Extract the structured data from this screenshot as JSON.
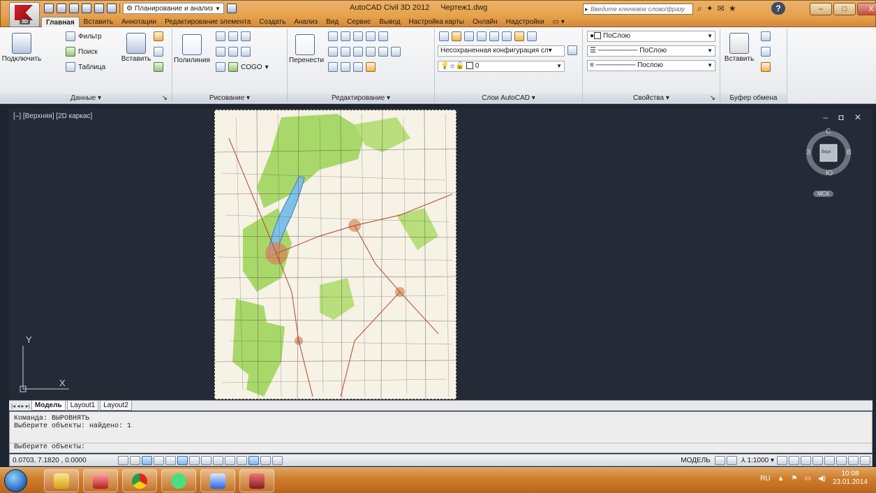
{
  "window": {
    "app_title": "AutoCAD Civil 3D 2012",
    "file_title": "Чертеж1.dwg",
    "workspace": "Планирование и анализ",
    "search_placeholder": "Введите ключевое слово/фразу",
    "app_badge": "3D",
    "help_label": "?",
    "minimize_glyph": "–",
    "maximize_glyph": "□",
    "close_glyph": "X"
  },
  "ribbon": {
    "tabs": [
      "Главная",
      "Вставить",
      "Аннотации",
      "Редактирование элемента",
      "Создать",
      "Анализ",
      "Вид",
      "Сервис",
      "Вывод",
      "Настройка карты",
      "Онлайн",
      "Надстройки"
    ],
    "active_tab": 0,
    "data_panel": {
      "title": "Данные ▾",
      "connect": "Подключить",
      "filter": "Фильтр",
      "search": "Поиск",
      "table": "Таблица",
      "insert": "Вставить",
      "expander": "↘"
    },
    "draw_panel": {
      "title": "Рисование ▾",
      "polyline": "Полилиния",
      "cogo": "COGO"
    },
    "edit_panel": {
      "title": "Редактирование ▾",
      "move": "Перенести"
    },
    "layers_panel": {
      "title": "Слои AutoCAD ▾",
      "layer_state": "Несохраненная конфигурация сл▾",
      "current_layer": "0"
    },
    "props_panel": {
      "title": "Свойства ▾",
      "color": "ПоСлою",
      "linetype": "ПоСлою",
      "lineweight": "Послою",
      "expander": "↘"
    },
    "clipboard_panel": {
      "title": "Буфер обмена",
      "paste": "Вставить"
    }
  },
  "viewport": {
    "label": "[–] [Верхняя] [2D каркас]",
    "controls": "– ◘ ✕",
    "viewcube": {
      "top": "С",
      "bottom": "Ю",
      "left": "З",
      "right": "В",
      "face": "Верх",
      "ucs": "МСК"
    },
    "ucs_x": "X",
    "ucs_y": "Y"
  },
  "layout_tabs": {
    "nav": "|◂ ◂ ▸ ▸|",
    "model": "Модель",
    "layout1": "Layout1",
    "layout2": "Layout2"
  },
  "command_line": {
    "history": [
      "Команда: ВЫРОВНЯТЬ",
      "Выберите объекты: найдено: 1"
    ],
    "prompt": "Выберите объекты:"
  },
  "status": {
    "coords": "0.0703, 7.1820 , 0.0000",
    "model": "МОДЕЛЬ",
    "scale": "1:1000 ▾"
  },
  "taskbar": {
    "lang": "RU",
    "time": "10:08",
    "date": "23.01.2014"
  },
  "colors": {
    "title_bar": "#e7a14b",
    "viewport_bg": "#252a37",
    "taskbar": "#cf7f2e",
    "map_green": "#a9d86a",
    "lake": "#7fc0e8"
  }
}
